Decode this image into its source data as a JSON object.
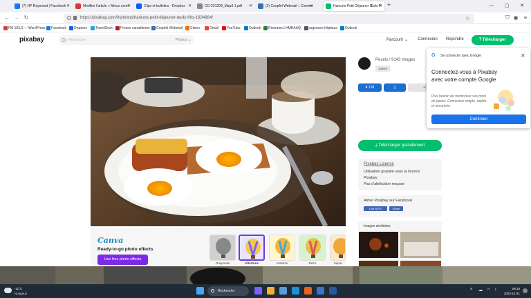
{
  "browser": {
    "tabs": [
      {
        "label": "(7) HP Raymond | Facebook",
        "color": "#1877f2"
      },
      {
        "label": "Modifier l'article « Mieux conn",
        "color": "#d63a3a"
      },
      {
        "label": "Clips et bulletins - Dropbox",
        "color": "#0061fe"
      },
      {
        "label": "CO-221209_Map3-1.pdf",
        "color": "#888888"
      },
      {
        "label": "(2) Coopfel Webmail :: Comme",
        "color": "#3b6fb5"
      },
      {
        "label": "Haricots Petit Déjeuner Œufs F",
        "color": "#02be6e"
      }
    ],
    "new_tab": "+",
    "url": "https://pixabay.com/fr/photos/haricots-petit-déjeuner-œufs-frits-1834984/",
    "bookmarks": [
      {
        "label": "FM 103,3 — WordPress",
        "color": "#d63a3a"
      },
      {
        "label": "Facebook",
        "color": "#1877f2"
      },
      {
        "label": "Dropbox",
        "color": "#0061fe"
      },
      {
        "label": "TweetDeck",
        "color": "#1da1f2"
      },
      {
        "label": "Presse canadienne",
        "color": "#b22222"
      },
      {
        "label": "Coopfel Webmail",
        "color": "#3b6fb5"
      },
      {
        "label": "Cision",
        "color": "#ff6600"
      },
      {
        "label": "Gmail",
        "color": "#ea4335"
      },
      {
        "label": "YouTube",
        "color": "#ff0000"
      },
      {
        "label": "Outlook",
        "color": "#0078d4"
      },
      {
        "label": "Riverains LHMHAAQ",
        "color": "#2e7d32"
      },
      {
        "label": "urgences hôpitaux",
        "color": "#555555"
      },
      {
        "label": "Outlook",
        "color": "#0078d4"
      }
    ]
  },
  "header": {
    "logo": "pixabay",
    "search_placeholder": "Rechercher",
    "search_type": "Photos",
    "links": [
      "Parcourir",
      "Connexion",
      "Rejoindre"
    ],
    "upload_label": "Télécharger"
  },
  "sidebar": {
    "author_stats": "Pexels / 9143 images",
    "follow_label": "Suivre",
    "like_count": "138",
    "download_free_label": "Télécharger gratuitement",
    "license_title": "Pixabay License",
    "license_lines": [
      "Utilisation gratuite sous la licence",
      "Pixabay",
      "Pas d'attribution requise"
    ],
    "fb_title": "Aimer Pixabay sur Facebook",
    "fb_like": "Like 857K",
    "fb_share": "Share",
    "similar_title": "Images similaires"
  },
  "canva": {
    "logo": "Canva",
    "subtitle": "Ready-to-go photo effects",
    "button": "Use free photo effects",
    "effects": [
      "Grayscale",
      "Aftertone",
      "Solarize",
      "Retro",
      "Sepia"
    ]
  },
  "google_popup": {
    "title": "Se connecter avec Google",
    "heading": "Connectez-vous à Pixabay avec votre compte Google",
    "text": "Plus besoin de mémoriser vos mots de passe. Connexion simple, rapide et sécurisée.",
    "button": "Continuer"
  },
  "taskbar": {
    "weather_temp": "-11°C",
    "weather_desc": "Nuageux",
    "search_label": "Recherche",
    "time": "09:10",
    "date": "2022-12-21"
  }
}
